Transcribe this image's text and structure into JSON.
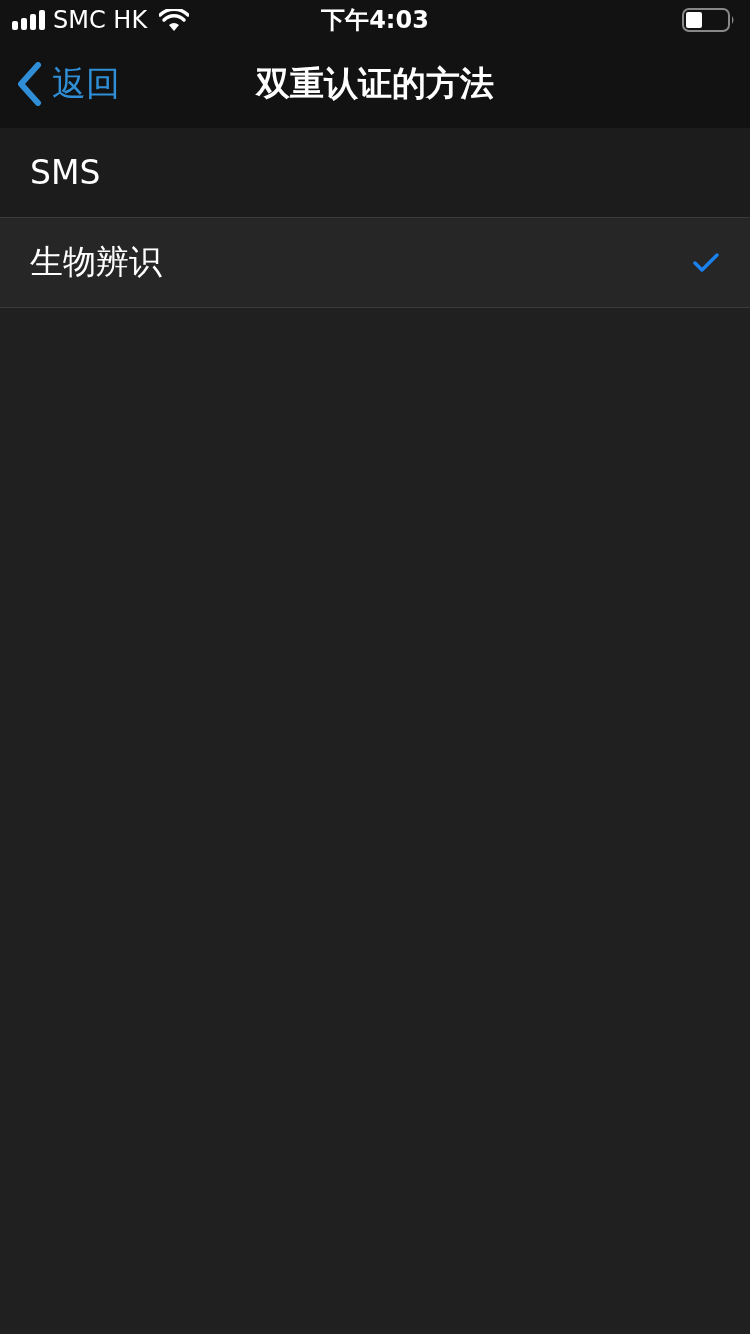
{
  "status_bar": {
    "carrier": "SMC HK",
    "time": "下午4:03"
  },
  "nav_bar": {
    "back": "返回",
    "title": "双重认证的方法"
  },
  "options": [
    {
      "label": "SMS",
      "selected": false
    },
    {
      "label": "生物辨识",
      "selected": true
    }
  ]
}
